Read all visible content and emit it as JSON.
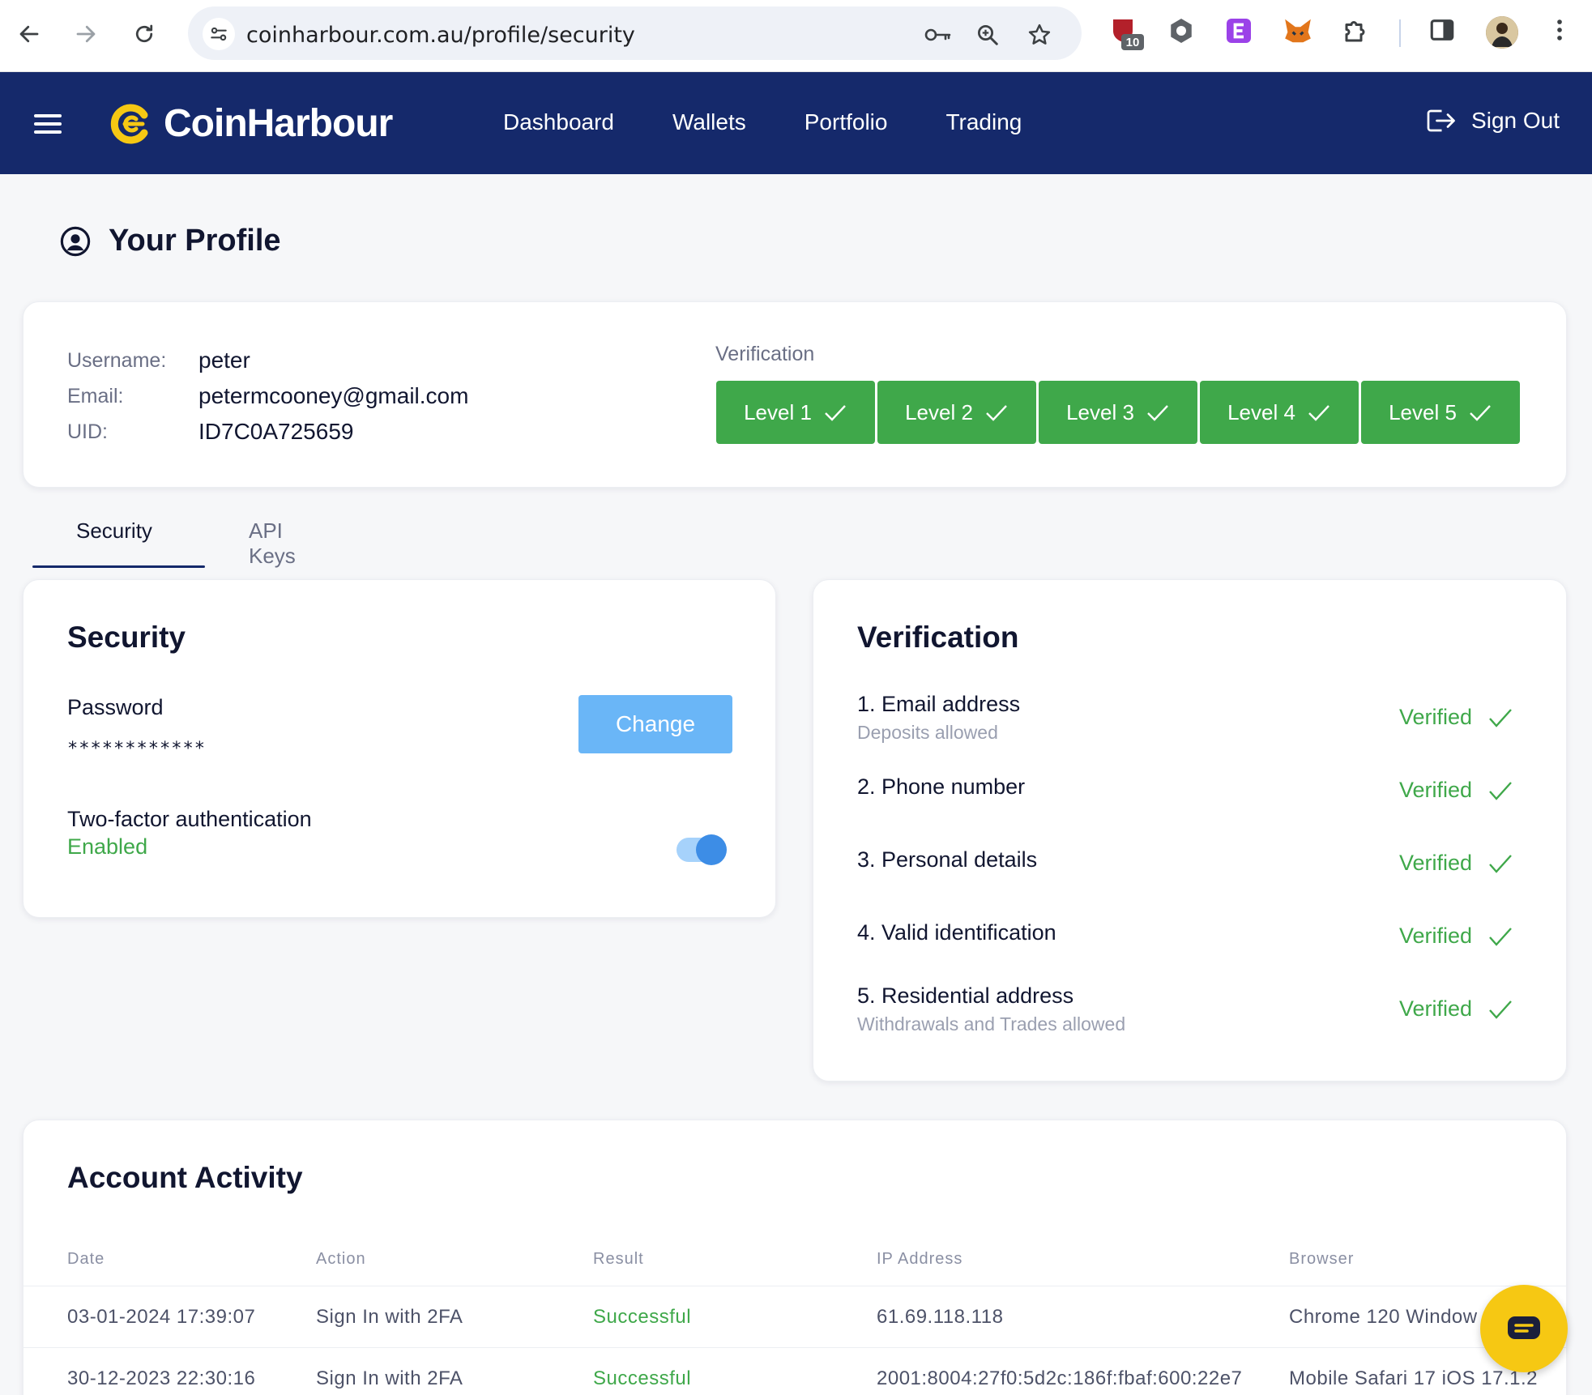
{
  "browser": {
    "url": "coinharbour.com.au/profile/security",
    "extension_badge": "10",
    "icons": [
      "back-icon",
      "forward-icon",
      "reload-icon",
      "site-settings-icon",
      "key-icon",
      "zoom-icon",
      "star-icon",
      "shield-extension-icon",
      "hexagon-extension-icon",
      "purple-extension-icon",
      "fox-extension-icon",
      "puzzle-icon",
      "sidepanel-icon",
      "avatar",
      "kebab-menu-icon"
    ]
  },
  "header": {
    "brand": "CoinHarbour",
    "nav": [
      "Dashboard",
      "Wallets",
      "Portfolio",
      "Trading"
    ],
    "sign_out": "Sign Out",
    "colors": {
      "bg": "#15296b",
      "logo": "#f6c813"
    }
  },
  "page": {
    "title": "Your Profile"
  },
  "profile": {
    "username_label": "Username:",
    "username": "peter",
    "email_label": "Email:",
    "email": "petermcooney@gmail.com",
    "uid_label": "UID:",
    "uid": "ID7C0A725659",
    "verification_label": "Verification",
    "levels": [
      "Level 1",
      "Level 2",
      "Level 3",
      "Level 4",
      "Level 5"
    ],
    "level_color": "#3fa84a"
  },
  "tabs": {
    "security": "Security",
    "api_keys": "API Keys",
    "active": "Security"
  },
  "security": {
    "heading": "Security",
    "password_label": "Password",
    "password_value": "************",
    "change_button": "Change",
    "tfa_label": "Two-factor authentication",
    "tfa_status": "Enabled",
    "tfa_enabled": true
  },
  "verification": {
    "heading": "Verification",
    "items": [
      {
        "title": "1.  Email address",
        "sub": "Deposits allowed",
        "status": "Verified"
      },
      {
        "title": "2. Phone number",
        "sub": "",
        "status": "Verified"
      },
      {
        "title": "3. Personal details",
        "sub": "",
        "status": "Verified"
      },
      {
        "title": "4. Valid identification",
        "sub": "",
        "status": "Verified"
      },
      {
        "title": "5. Residential address",
        "sub": "Withdrawals and Trades allowed",
        "status": "Verified"
      }
    ]
  },
  "activity": {
    "heading": "Account Activity",
    "columns": [
      "Date",
      "Action",
      "Result",
      "IP Address",
      "Browser"
    ],
    "rows": [
      [
        "03-01-2024 17:39:07",
        "Sign In with 2FA",
        "Successful",
        "61.69.118.118",
        "Chrome 120 Window"
      ],
      [
        "30-12-2023 22:30:16",
        "Sign In with 2FA",
        "Successful",
        "2001:8004:27f0:5d2c:186f:fbaf:600:22e7",
        "Mobile Safari 17 iOS 17.1.2"
      ]
    ]
  }
}
